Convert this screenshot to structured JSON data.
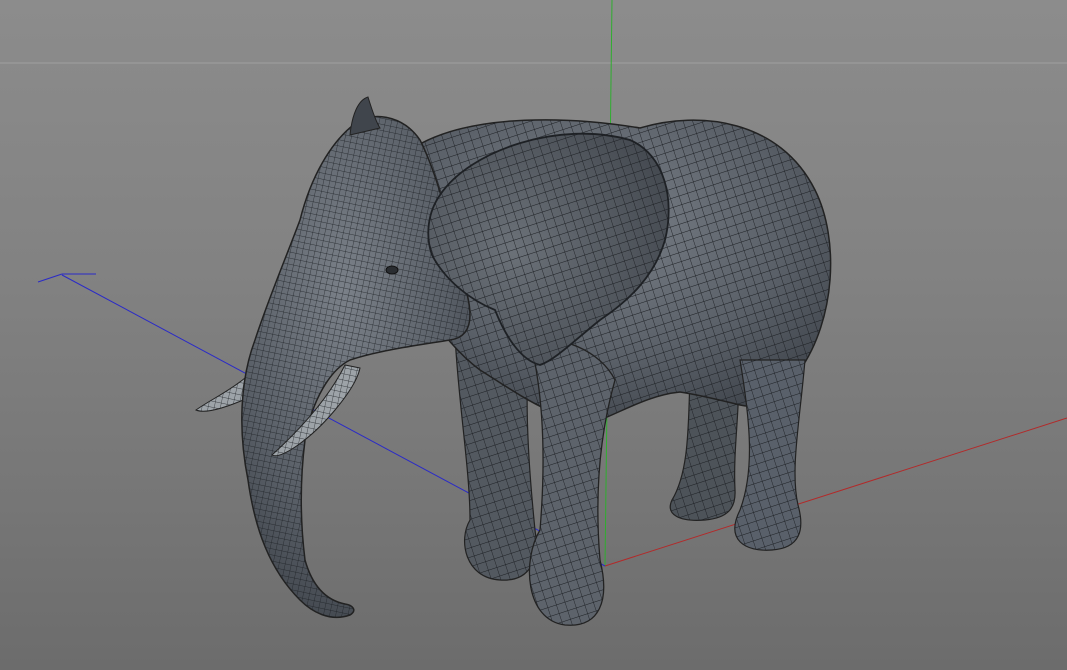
{
  "viewport": {
    "scene_object": "elephant-model",
    "display_mode": "wireframe-shaded",
    "colors": {
      "background_top": "#8c8c8c",
      "background_bottom": "#6c6c6c",
      "horizon_line": "#a0a0a0",
      "axis_x": "#b22a2a",
      "axis_y": "#2fae2f",
      "axis_z": "#2a2ac8",
      "mesh_fill": "#565c63",
      "mesh_wire": "#1c1f23",
      "tusk_fill": "#9da3a8"
    }
  }
}
